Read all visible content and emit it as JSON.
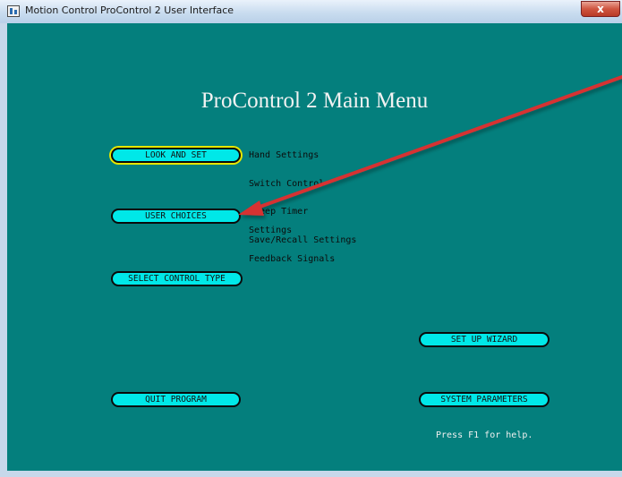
{
  "window": {
    "title": "Motion Control ProControl 2 User Interface",
    "close_glyph": "x"
  },
  "main": {
    "heading": "ProControl 2 Main Menu",
    "buttons": {
      "look_and_set": "LOOK AND SET",
      "user_choices": "USER CHOICES",
      "select_control_type": "SELECT CONTROL TYPE",
      "quit_program": "QUIT PROGRAM",
      "set_up_wizard": "SET UP WIZARD",
      "system_parameters": "SYSTEM PARAMETERS"
    },
    "look_and_set_items": [
      "Hand Settings",
      "Switch Control",
      "Sleep Timer",
      "Save/Recall Settings"
    ],
    "user_choices_items": [
      "Settings",
      "Feedback Signals"
    ],
    "help_text": "Press F1 for help."
  },
  "colors": {
    "background": "#047f7d",
    "button_fill": "#00e8e8",
    "focus_ring": "#e6e600",
    "annotation_arrow": "#d63030"
  }
}
